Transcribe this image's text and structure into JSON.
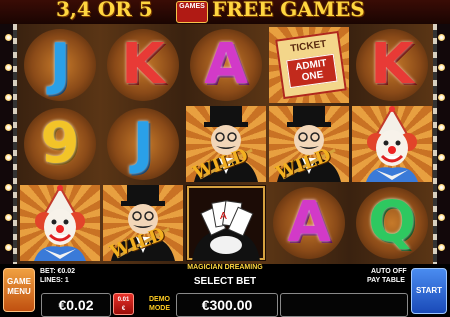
{
  "banner": {
    "left": "3,4 OR 5",
    "right": "FREE GAMES",
    "logo_line1": "",
    "logo_line2": "GAMES"
  },
  "reels": {
    "symbols": [
      [
        "J",
        "9",
        "clown"
      ],
      [
        "K",
        "J",
        "magician-wild"
      ],
      [
        "A",
        "magician-wild",
        "magician-cards"
      ],
      [
        "ticket",
        "magician-wild",
        "A"
      ],
      [
        "K",
        "clown",
        "Q"
      ]
    ],
    "wild_label": "WILD",
    "ticket_label": "TICKET",
    "ticket_admit": "ADMIT ONE"
  },
  "bottom": {
    "menu_label_1": "GAME",
    "menu_label_2": "MENU",
    "bet_label": "BET: €0.02",
    "lines_label": "LINES: 1",
    "game_name": "MAGICIAN DREAMING",
    "select_bet": "SELECT BET",
    "autoplay": "AUTO OFF",
    "paytable": "PAY TABLE",
    "bet_value": "€0.02",
    "coin_1": "0.01",
    "coin_2": "€",
    "demo_1": "DEMO",
    "demo_2": "MODE",
    "balance": "€300.00",
    "start": "START"
  },
  "colors": {
    "accent_gold": "#ffd640",
    "start_blue": "#1a4ab8",
    "menu_orange": "#c05010"
  }
}
